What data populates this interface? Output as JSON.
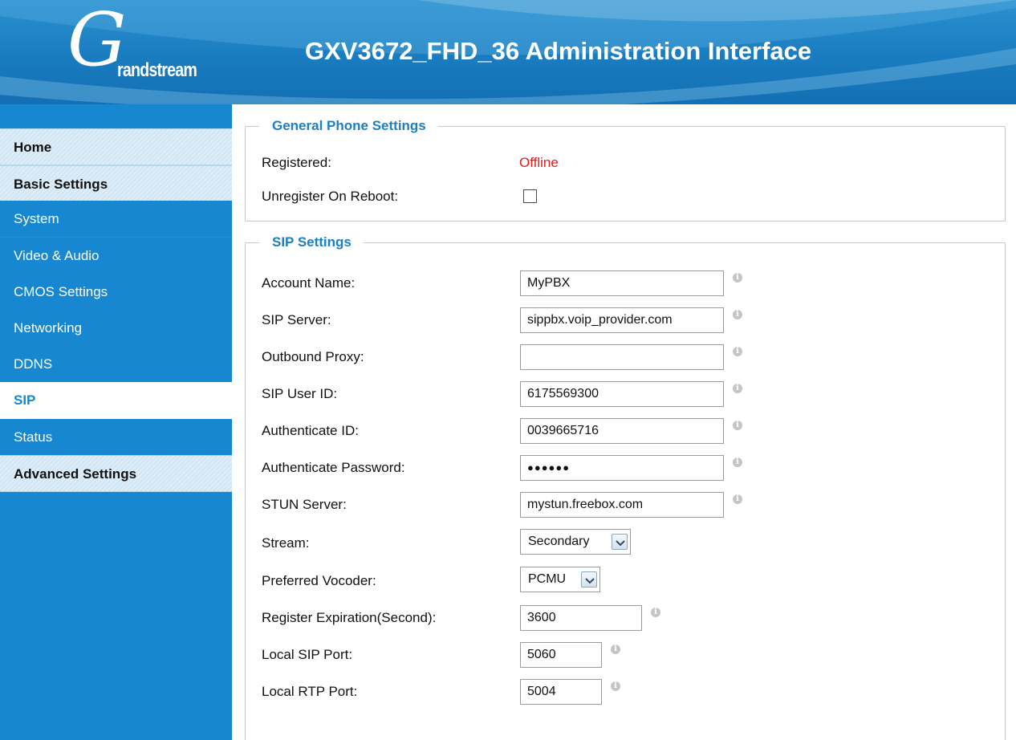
{
  "header": {
    "logo_glyph": "G",
    "logo_text": "randstream",
    "title": "GXV3672_FHD_36 Administration Interface"
  },
  "sidebar": {
    "items": [
      {
        "label": "Home"
      },
      {
        "label": "Basic Settings"
      },
      {
        "label": "System"
      },
      {
        "label": "Video & Audio"
      },
      {
        "label": "CMOS Settings"
      },
      {
        "label": "Networking"
      },
      {
        "label": "DDNS"
      },
      {
        "label": "SIP"
      },
      {
        "label": "Status"
      },
      {
        "label": "Advanced Settings"
      }
    ],
    "active": "SIP"
  },
  "general": {
    "legend": "General Phone Settings",
    "registered_label": "Registered:",
    "registered_value": "Offline",
    "unregister_label": "Unregister On Reboot:",
    "unregister_checked": false
  },
  "sip": {
    "legend": "SIP Settings",
    "account_name_label": "Account Name:",
    "account_name_value": "MyPBX",
    "sip_server_label": "SIP Server:",
    "sip_server_value": "sippbx.voip_provider.com",
    "outbound_proxy_label": "Outbound Proxy:",
    "outbound_proxy_value": "",
    "sip_user_id_label": "SIP User ID:",
    "sip_user_id_value": "6175569300",
    "auth_id_label": "Authenticate ID:",
    "auth_id_value": "0039665716",
    "auth_password_label": "Authenticate Password:",
    "auth_password_value": "●●●●●●",
    "stun_server_label": "STUN Server:",
    "stun_server_value": "mystun.freebox.com",
    "stream_label": "Stream:",
    "stream_value": "Secondary",
    "vocoder_label": "Preferred Vocoder:",
    "vocoder_value": "PCMU",
    "register_expiration_label": "Register Expiration(Second):",
    "register_expiration_value": "3600",
    "local_sip_port_label": "Local SIP Port:",
    "local_sip_port_value": "5060",
    "local_rtp_port_label": "Local RTP Port:",
    "local_rtp_port_value": "5004"
  },
  "icons": {
    "info": "info-icon",
    "dropdown": "chevron-down-icon"
  },
  "colors": {
    "sidebar_blue": "#1687d0",
    "header_blue": "#1a7cc0",
    "legend_blue": "#1a7fc4",
    "offline_red": "#e31b1b"
  }
}
